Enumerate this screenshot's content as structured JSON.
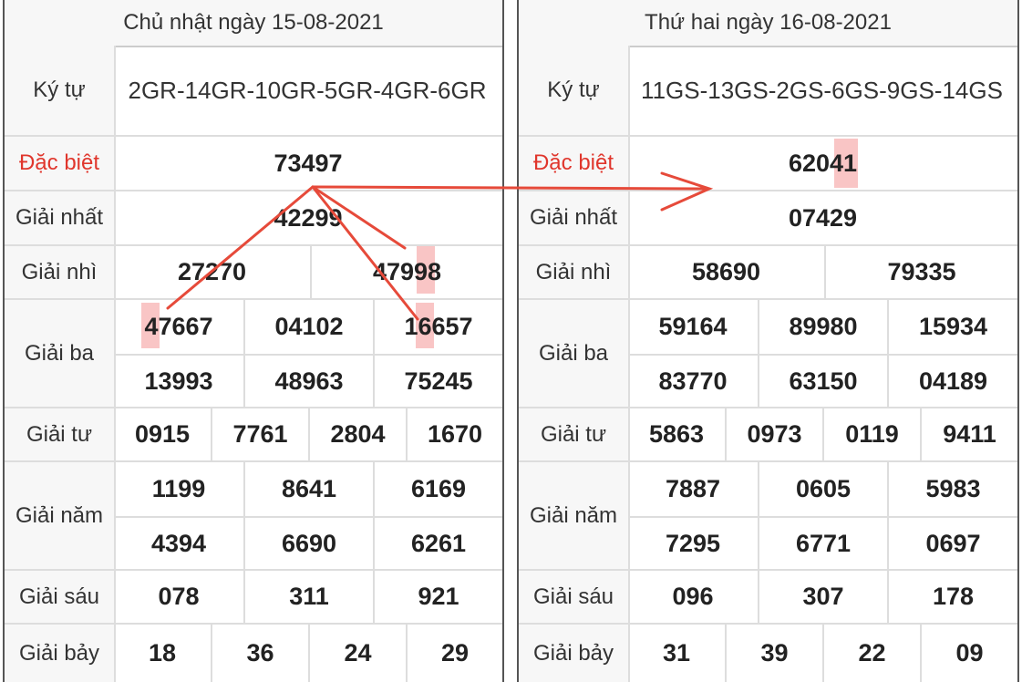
{
  "left": {
    "date": "Chủ nhật ngày 15-08-2021",
    "labels": {
      "kytu": "Ký tự",
      "db": "Đặc biệt",
      "g1": "Giải nhất",
      "g2": "Giải nhì",
      "g3": "Giải ba",
      "g4": "Giải tư",
      "g5": "Giải năm",
      "g6": "Giải sáu",
      "g7": "Giải bảy"
    },
    "kytu": "2GR-14GR-10GR-5GR-4GR-6GR",
    "db": "73497",
    "g1": "42299",
    "g2": [
      "27270",
      "47998"
    ],
    "g3": [
      "47667",
      "04102",
      "16657",
      "13993",
      "48963",
      "75245"
    ],
    "g4": [
      "0915",
      "7761",
      "2804",
      "1670"
    ],
    "g5": [
      "1199",
      "8641",
      "6169",
      "4394",
      "6690",
      "6261"
    ],
    "g6": [
      "078",
      "311",
      "921"
    ],
    "g7": [
      "18",
      "36",
      "24",
      "29"
    ]
  },
  "right": {
    "date": "Thứ hai ngày 16-08-2021",
    "labels": {
      "kytu": "Ký tự",
      "db": "Đặc biệt",
      "g1": "Giải nhất",
      "g2": "Giải nhì",
      "g3": "Giải ba",
      "g4": "Giải tư",
      "g5": "Giải năm",
      "g6": "Giải sáu",
      "g7": "Giải bảy"
    },
    "kytu": "11GS-13GS-2GS-6GS-9GS-14GS",
    "db": "62041",
    "g1": "07429",
    "g2": [
      "58690",
      "79335"
    ],
    "g3": [
      "59164",
      "89980",
      "15934",
      "83770",
      "63150",
      "04189"
    ],
    "g4": [
      "5863",
      "0973",
      "0119",
      "9411"
    ],
    "g5": [
      "7887",
      "0605",
      "5983",
      "7295",
      "6771",
      "0697"
    ],
    "g6": [
      "096",
      "307",
      "178"
    ],
    "g7": [
      "31",
      "39",
      "22",
      "09"
    ]
  },
  "colors": {
    "accent": "#e0362c",
    "highlight": "#f06e6e"
  }
}
